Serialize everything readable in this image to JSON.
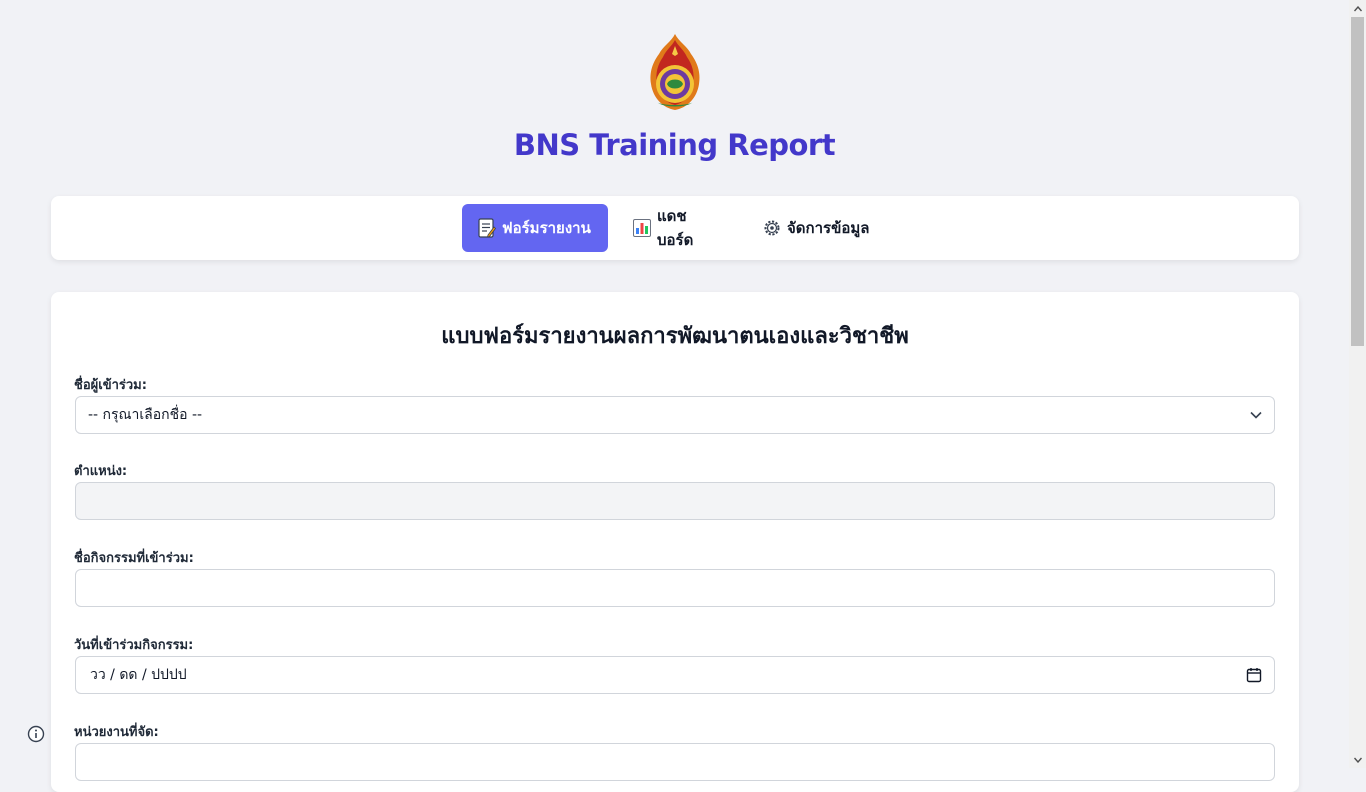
{
  "header": {
    "app_title": "BNS Training Report",
    "logo_icon": "obec-emblem-icon"
  },
  "nav": {
    "tabs": [
      {
        "label": "ฟอร์มรายงาน",
        "icon": "memo-icon",
        "active": true
      },
      {
        "label": "แดชบอร์ด",
        "icon": "bar-chart-icon",
        "active": false
      },
      {
        "label": "จัดการข้อมูล",
        "icon": "gear-icon",
        "active": false
      }
    ],
    "accent_color": "#6366f1"
  },
  "form": {
    "title": "แบบฟอร์มรายงานผลการพัฒนาตนเองและวิชาชีพ",
    "participant": {
      "label": "ชื่อผู้เข้าร่วม:",
      "selected": "-- กรุณาเลือกชื่อ --"
    },
    "position": {
      "label": "ตำแหน่ง:",
      "value": ""
    },
    "activity": {
      "label": "ชื่อกิจกรรมที่เข้าร่วม:",
      "value": ""
    },
    "date": {
      "label": "วันที่เข้าร่วมกิจกรรม:",
      "placeholder": "วว / ดด / ปปปป"
    },
    "organizer": {
      "label": "หน่วยงานที่จัด:",
      "value": ""
    }
  },
  "colors": {
    "title": "#4338ca",
    "background": "#f1f2f6"
  }
}
